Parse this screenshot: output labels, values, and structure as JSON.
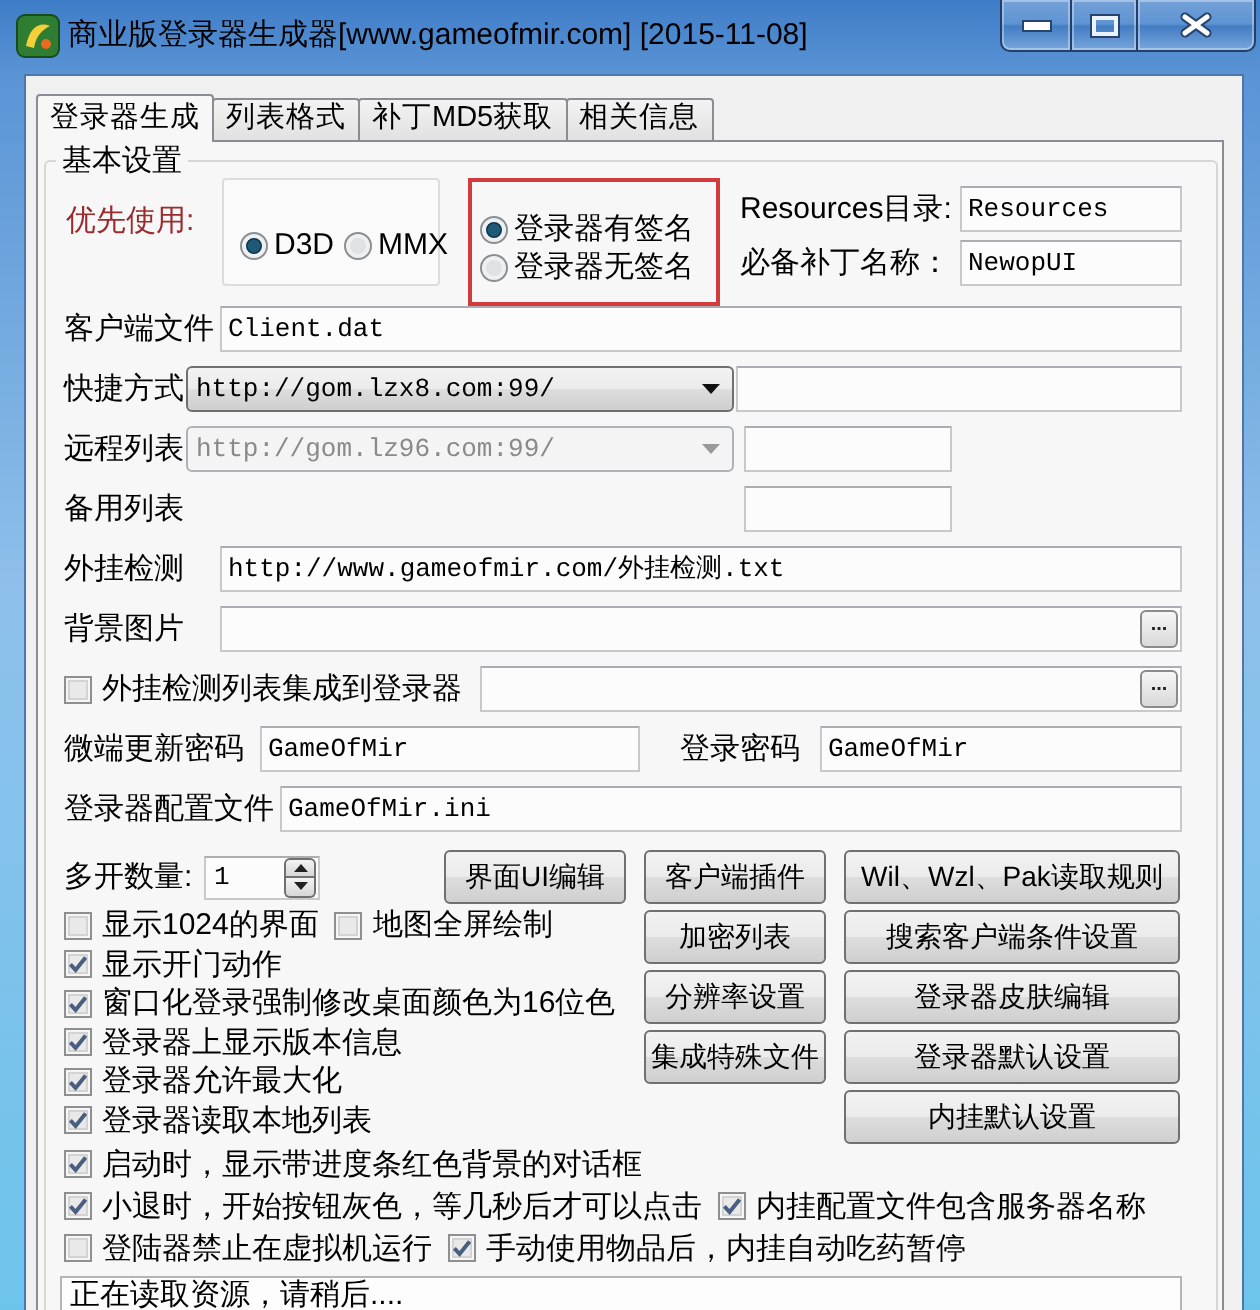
{
  "window": {
    "title": "商业版登录器生成器[www.gameofmir.com] [2015-11-08]",
    "controls": [
      {
        "kind": "minimize"
      },
      {
        "kind": "maximize"
      },
      {
        "kind": "close"
      }
    ]
  },
  "tabs": [
    {
      "label": "登录器生成",
      "selected": true
    },
    {
      "label": "列表格式",
      "selected": false
    },
    {
      "label": "补丁MD5获取",
      "selected": false
    },
    {
      "label": "相关信息",
      "selected": false
    }
  ],
  "group": {
    "title": "基本设置"
  },
  "engine": {
    "label": "优先使用:",
    "options": [
      {
        "label": "D3D",
        "selected": true
      },
      {
        "label": "MMX",
        "selected": false
      }
    ]
  },
  "signature": {
    "highlighted": true,
    "options": [
      {
        "label": "登录器有签名",
        "selected": true
      },
      {
        "label": "登录器无签名",
        "selected": false
      }
    ]
  },
  "resources_dir": {
    "label": "Resources目录:",
    "value": "Resources"
  },
  "patch_name": {
    "label": "必备补丁名称：",
    "value": "NewopUI"
  },
  "client_file": {
    "label": "客户端文件",
    "value": "Client.dat"
  },
  "shortcut": {
    "label": "快捷方式",
    "combo": {
      "value": "http://gom.lzx8.com:99/",
      "disabled": false
    }
  },
  "remote_list": {
    "label": "远程列表",
    "combo": {
      "value": "http://gom.lz96.com:99/",
      "disabled": true
    }
  },
  "backup_list": {
    "label": "备用列表"
  },
  "plugin_check": {
    "label": "外挂检测",
    "value": "http://www.gameofmir.com/外挂检测.txt"
  },
  "background_image": {
    "label": "背景图片",
    "browse": "..."
  },
  "plugin_list": {
    "label": "外挂检测列表集成到登录器",
    "checked": false,
    "browse": "..."
  },
  "micro_password": {
    "label": "微端更新密码",
    "value": "GameOfMir"
  },
  "login_password": {
    "label": "登录密码",
    "value": "GameOfMir"
  },
  "config_file": {
    "label": "登录器配置文件",
    "value": "GameOfMir.ini"
  },
  "instances": {
    "label": "多开数量:",
    "value": "1"
  },
  "ui_edit_button": "界面UI编辑",
  "button_columns": [
    [
      "客户端插件",
      "加密列表",
      "分辨率设置",
      "集成特殊文件"
    ],
    [
      "Wil、Wzl、Pak读取规则",
      "搜索客户端条件设置",
      "登录器皮肤编辑",
      "登录器默认设置",
      "内挂默认设置"
    ]
  ],
  "side_options": [
    [
      {
        "label": "显示1024的界面",
        "checked": false
      },
      {
        "label": "地图全屏绘制",
        "checked": false
      }
    ],
    [
      {
        "label": "显示开门动作",
        "checked": true
      }
    ],
    [
      {
        "label": "窗口化登录强制修改桌面颜色为16位色",
        "checked": true
      }
    ],
    [
      {
        "label": "登录器上显示版本信息",
        "checked": true
      }
    ],
    [
      {
        "label": "登录器允许最大化",
        "checked": true
      }
    ],
    [
      {
        "label": "登录器读取本地列表",
        "checked": true
      }
    ]
  ],
  "bottom_options": [
    [
      {
        "label": "启动时，显示带进度条红色背景的对话框",
        "checked": true
      }
    ],
    [
      {
        "label": "小退时，开始按钮灰色，等几秒后才可以点击",
        "checked": true
      },
      {
        "label": "内挂配置文件包含服务器名称",
        "checked": true
      }
    ],
    [
      {
        "label": "登陆器禁止在虚拟机运行",
        "checked": false
      },
      {
        "label": "手动使用物品后，内挂自动吃药暂停",
        "checked": true
      }
    ]
  ],
  "status": "正在读取资源，请稍后...."
}
